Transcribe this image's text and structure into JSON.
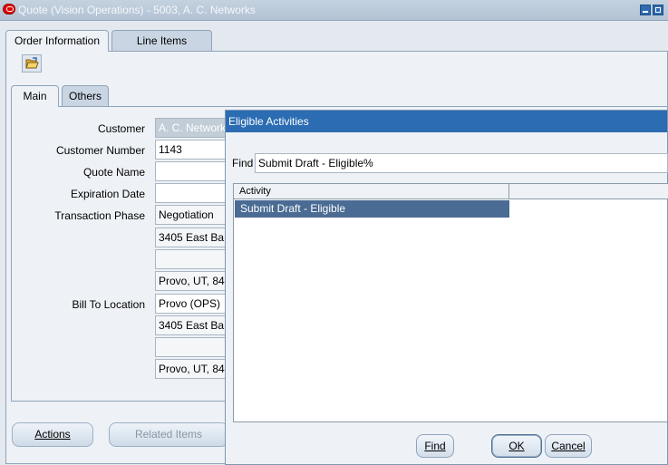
{
  "window": {
    "title": "Quote (Vision Operations) - 5003, A. C. Networks"
  },
  "tabs": [
    {
      "label": "Order Information"
    },
    {
      "label": "Line Items"
    }
  ],
  "subtabs": [
    {
      "label": "Main"
    },
    {
      "label": "Others"
    }
  ],
  "form": {
    "customer_label": "Customer",
    "customer_value": "A. C. Networks",
    "customer_number_label": "Customer Number",
    "customer_number_value": "1143",
    "quote_name_label": "Quote Name",
    "quote_name_value": "",
    "expiration_date_label": "Expiration Date",
    "expiration_date_value": "",
    "transaction_phase_label": "Transaction Phase",
    "transaction_phase_value": "Negotiation",
    "address_line1": "3405 East Ba",
    "address_line2": "",
    "address_city": "Provo, UT, 84",
    "bill_to_label": "Bill To Location",
    "bill_to_value": "Provo (OPS)",
    "bill_address_line1": "3405 East Ba",
    "bill_address_line2": "",
    "bill_address_city": "Provo, UT, 84"
  },
  "buttons": {
    "actions": "Actions",
    "related_items": "Related Items"
  },
  "dialog": {
    "title": "Eligible Activities",
    "find_label": "Find",
    "find_value": "Submit Draft - Eligible%",
    "column_header": "Activity",
    "rows": [
      "Submit Draft - Eligible"
    ],
    "find_button": "Find",
    "ok_button": "OK",
    "cancel_button": "Cancel"
  },
  "colors": {
    "dialog_title_bar": "#2b6cb3",
    "selected_row": "#4a6b93",
    "window_background": "#e4e9ef"
  },
  "icons": {
    "app": "oracle-logo-icon",
    "toolbar": "open-folder-icon"
  }
}
